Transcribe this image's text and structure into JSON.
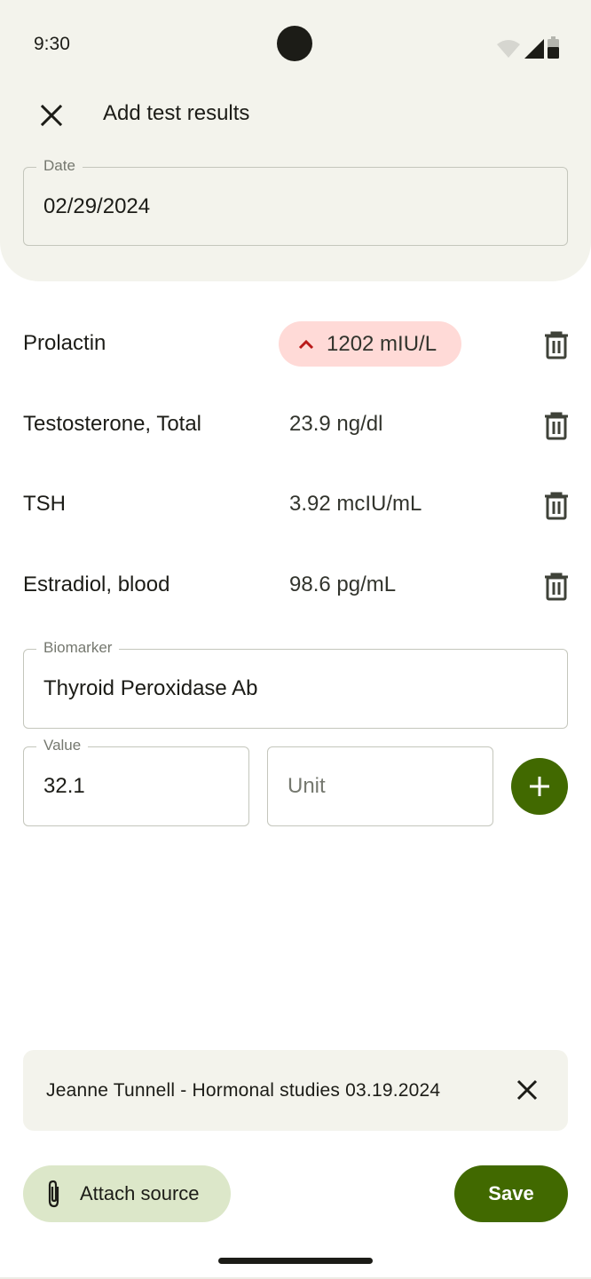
{
  "status_bar": {
    "time": "9:30",
    "icons": [
      "wifi-icon",
      "signal-icon",
      "battery-icon"
    ]
  },
  "app_bar": {
    "title": "Add test results",
    "close_icon": "close-icon"
  },
  "date_field": {
    "label": "Date",
    "value": "02/29/2024"
  },
  "results": [
    {
      "name": "Prolactin",
      "value": "1202 mIU/L",
      "flag": "high",
      "flag_icon": "chevron-up-icon"
    },
    {
      "name": "Testosterone, Total",
      "value": "23.9 ng/dl",
      "flag": null
    },
    {
      "name": "TSH",
      "value": "3.92 mcIU/mL",
      "flag": null
    },
    {
      "name": "Estradiol, blood",
      "value": "98.6 pg/mL",
      "flag": null
    }
  ],
  "new_entry": {
    "biomarker": {
      "label": "Biomarker",
      "value": "Thyroid Peroxidase Ab"
    },
    "value": {
      "label": "Value",
      "value": "32.1"
    },
    "unit": {
      "placeholder": "Unit",
      "value": ""
    },
    "add_icon": "plus-icon"
  },
  "source": {
    "text": "Jeanne Tunnell - Hormonal studies 03.19.2024",
    "remove_icon": "close-icon"
  },
  "actions": {
    "attach_label": "Attach source",
    "attach_icon": "paperclip-icon",
    "save_label": "Save"
  },
  "colors": {
    "primary": "#416900",
    "primary_container": "#dce7c9",
    "surface_container": "#f3f3ec",
    "flag_high_bg": "#ffdad7",
    "flag_high_icon": "#ba1a1a"
  }
}
